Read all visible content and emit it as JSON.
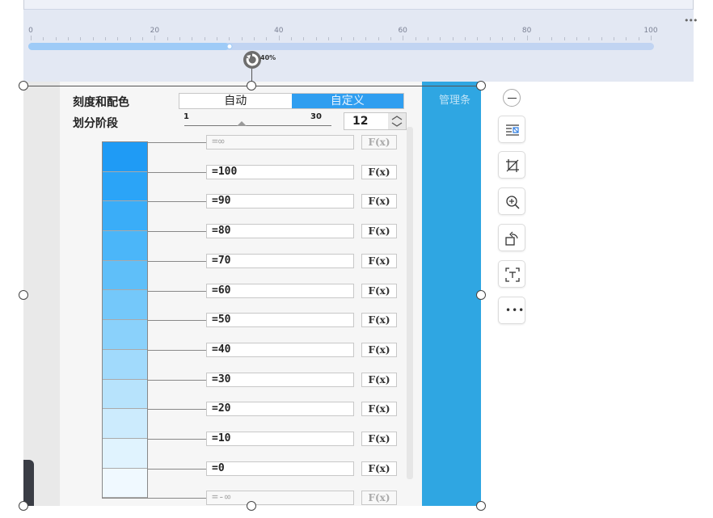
{
  "ruler": {
    "tick_labels": [
      "0",
      "20",
      "40",
      "60",
      "80",
      "100"
    ],
    "progress_percent": 40,
    "rotation_label": "40%",
    "more_label": "•••"
  },
  "panel": {
    "scale_label": "刻度和配色",
    "mode_auto": "自动",
    "mode_custom": "自定义",
    "mode_selected": "自定义",
    "stage_label": "划分阶段",
    "stage_min": "1",
    "stage_max": "30",
    "stage_value": "12",
    "side_text": "管理条",
    "fx_label": "F(x)",
    "rows": [
      {
        "value": "=∞",
        "dim": true,
        "color": "#ffffff"
      },
      {
        "value": "=100",
        "dim": false,
        "color": "#1f9bf5"
      },
      {
        "value": "=90",
        "dim": false,
        "color": "#2ba4f7"
      },
      {
        "value": "=80",
        "dim": false,
        "color": "#3aadf8"
      },
      {
        "value": "=70",
        "dim": false,
        "color": "#4bb6f9"
      },
      {
        "value": "=60",
        "dim": false,
        "color": "#5fbff9"
      },
      {
        "value": "=50",
        "dim": false,
        "color": "#74c8fa"
      },
      {
        "value": "=40",
        "dim": false,
        "color": "#8ad1fb"
      },
      {
        "value": "=30",
        "dim": false,
        "color": "#a1dafc"
      },
      {
        "value": "=20",
        "dim": false,
        "color": "#b7e3fc"
      },
      {
        "value": "=10",
        "dim": false,
        "color": "#ccebfd"
      },
      {
        "value": "=0",
        "dim": false,
        "color": "#e0f3fe"
      },
      {
        "value": "=-∞",
        "dim": true,
        "color": "#f0f9ff"
      }
    ]
  },
  "toolbar": {
    "icons": [
      "minus-icon",
      "wrap-text-icon",
      "crop-icon",
      "zoom-in-icon",
      "rotate-icon",
      "ocr-text-icon",
      "more-icon"
    ]
  }
}
